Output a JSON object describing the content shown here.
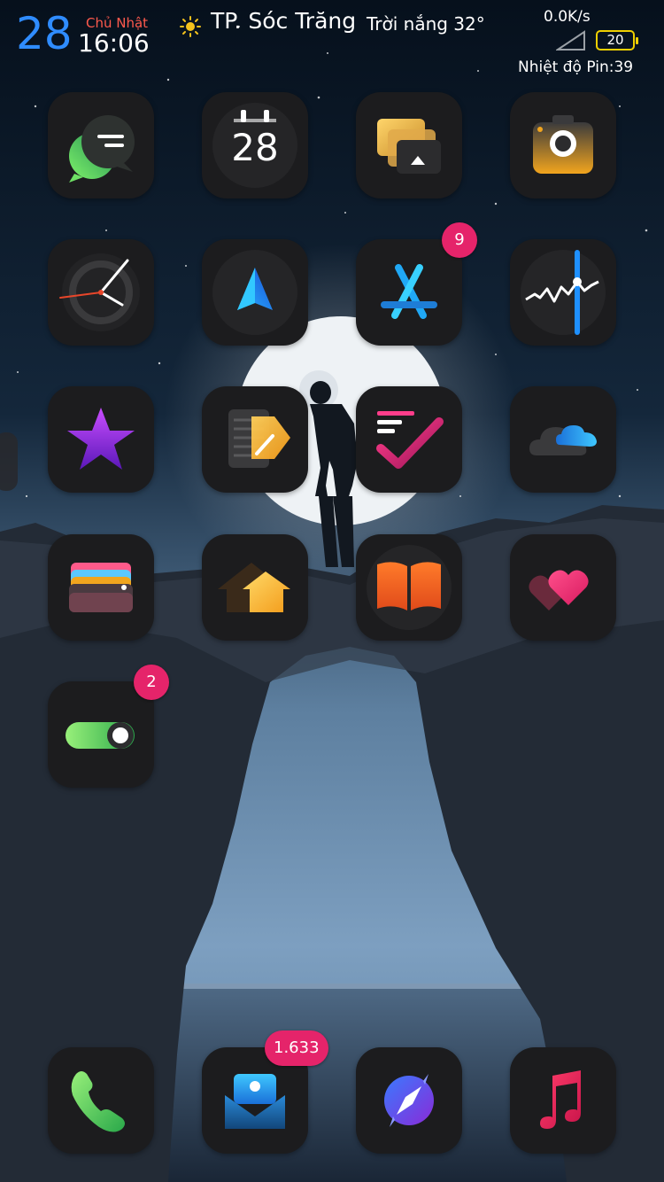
{
  "status_bar": {
    "day_number": "28",
    "weekday": "Chủ Nhật",
    "time": "16:06",
    "city": "TP. Sóc Trăng",
    "weather": "Trời nắng 32°",
    "net_speed": "0.0K/s",
    "battery_level": "20",
    "battery_temperature": "Nhiệt độ Pin:39"
  },
  "apps": [
    {
      "icon": "messages-icon"
    },
    {
      "icon": "calendar-icon",
      "date": "28"
    },
    {
      "icon": "photos-icon"
    },
    {
      "icon": "camera-icon"
    },
    {
      "icon": "clock-icon"
    },
    {
      "icon": "navigation-icon"
    },
    {
      "icon": "app-store-icon",
      "badge": "9"
    },
    {
      "icon": "stocks-icon"
    },
    {
      "icon": "star-icon"
    },
    {
      "icon": "notes-icon"
    },
    {
      "icon": "reminders-icon"
    },
    {
      "icon": "cloud-icon"
    },
    {
      "icon": "wallet-icon"
    },
    {
      "icon": "home-icon"
    },
    {
      "icon": "books-icon"
    },
    {
      "icon": "hearts-icon"
    },
    {
      "icon": "toggle-settings-icon",
      "badge": "2"
    }
  ],
  "dock": [
    {
      "icon": "phone-icon"
    },
    {
      "icon": "mail-icon",
      "badge": "1.633"
    },
    {
      "icon": "compass-icon"
    },
    {
      "icon": "music-icon"
    }
  ],
  "colors": {
    "date_blue": "#2f8cff",
    "weekday_red": "#ff5a4d",
    "badge_pink": "#e5246a",
    "battery_yellow": "#f0d000",
    "tile_bg": "#1c1c1e"
  }
}
